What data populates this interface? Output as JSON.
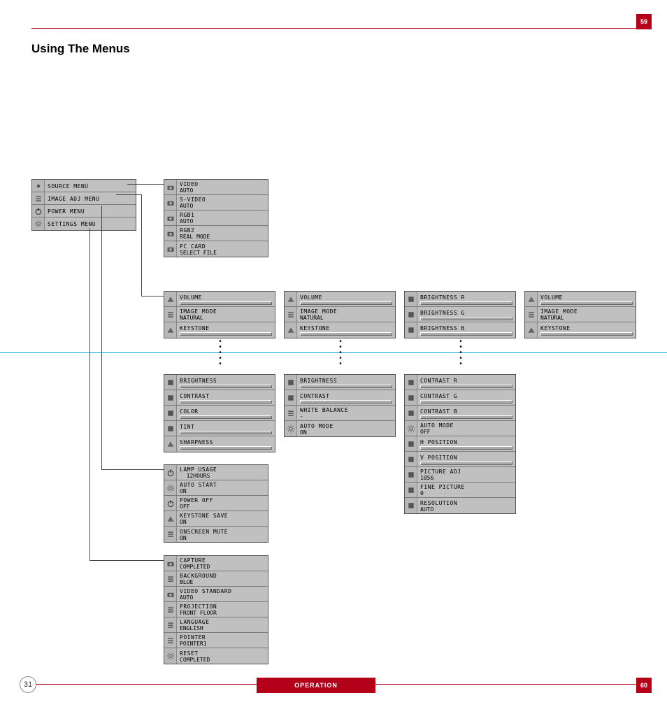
{
  "page": {
    "top_right_number": "59",
    "title": "Using The Menus",
    "footer_circle": "31",
    "footer_band": "OPERATION",
    "footer_right_number": "60"
  },
  "main_menu": [
    {
      "label": "SOURCE MENU"
    },
    {
      "label": "IMAGE ADJ MENU"
    },
    {
      "label": "POWER MENU"
    },
    {
      "label": "SETTINGS MENU"
    }
  ],
  "source_menu": [
    {
      "label": "VIDEO",
      "value": "AUTO"
    },
    {
      "label": "S-VIDEO",
      "value": "AUTO"
    },
    {
      "label": "RGB1",
      "value": "AUTO"
    },
    {
      "label": "RGB2",
      "value": "REAL MODE"
    },
    {
      "label": "PC CARD",
      "value": "SELECT FILE"
    }
  ],
  "img_adj_a": [
    {
      "label": "VOLUME",
      "slider": true,
      "value": "-"
    },
    {
      "label": "IMAGE MODE",
      "value": "NATURAL"
    },
    {
      "label": "KEYSTONE",
      "slider": true,
      "value": "-"
    }
  ],
  "img_adj_a2": [
    {
      "label": "BRIGHTNESS",
      "slider": true,
      "value": "-"
    },
    {
      "label": "CONTRAST",
      "slider": true,
      "value": "-"
    },
    {
      "label": "COLOR",
      "slider": true,
      "value": "-"
    },
    {
      "label": "TINT",
      "slider": true,
      "value": "-"
    },
    {
      "label": "SHARPNESS",
      "slider": true,
      "value": "-"
    }
  ],
  "img_adj_b": [
    {
      "label": "VOLUME",
      "slider": true,
      "value": "-"
    },
    {
      "label": "IMAGE MODE",
      "value": "NATURAL"
    },
    {
      "label": "KEYSTONE",
      "slider": true,
      "value": "-"
    }
  ],
  "img_adj_b2": [
    {
      "label": "BRIGHTNESS",
      "slider": true,
      "value": "-"
    },
    {
      "label": "CONTRAST",
      "slider": true,
      "value": "-"
    },
    {
      "label": "WHITE BALANCE",
      "value": "-"
    },
    {
      "label": "AUTO MODE",
      "value": "ON"
    }
  ],
  "img_adj_c": [
    {
      "label": "BRIGHTNESS R",
      "slider": true,
      "value": "-"
    },
    {
      "label": "BRIGHTNESS G",
      "slider": true,
      "value": "-"
    },
    {
      "label": "BRIGHTNESS B",
      "slider": true,
      "value": "-"
    }
  ],
  "img_adj_c2": [
    {
      "label": "CONTRAST R",
      "slider": true,
      "value": "-"
    },
    {
      "label": "CONTRAST G",
      "slider": true,
      "value": "-"
    },
    {
      "label": "CONTRAST B",
      "slider": true,
      "value": "-"
    },
    {
      "label": "AUTO MODE",
      "value": "OFF"
    },
    {
      "label": "H POSITION",
      "slider": true,
      "value": "-"
    },
    {
      "label": "V POSITION",
      "slider": true,
      "value": "-"
    },
    {
      "label": "PICTURE ADJ",
      "value": "1056"
    },
    {
      "label": "FINE PICTURE",
      "value": "0"
    },
    {
      "label": "RESOLUTION",
      "value": "AUTO"
    }
  ],
  "img_adj_d": [
    {
      "label": "VOLUME",
      "slider": true,
      "value": "-"
    },
    {
      "label": "IMAGE MODE",
      "value": "NATURAL"
    },
    {
      "label": "KEYSTONE",
      "slider": true,
      "value": "-"
    }
  ],
  "power_menu": [
    {
      "label": "LAMP USAGE",
      "value": "  12HOURS"
    },
    {
      "label": "AUTO START",
      "value": "ON"
    },
    {
      "label": "POWER OFF",
      "value": "OFF"
    },
    {
      "label": "KEYSTONE SAVE",
      "value": "ON"
    },
    {
      "label": "ONSCREEN MUTE",
      "value": "ON"
    }
  ],
  "settings_menu": [
    {
      "label": "CAPTURE",
      "value": "COMPLETED"
    },
    {
      "label": "BACKGROUND",
      "value": "BLUE"
    },
    {
      "label": "VIDEO STANDARD",
      "value": "AUTO"
    },
    {
      "label": "PROJECTION",
      "value": "FRONT FLOOR"
    },
    {
      "label": "LANGUAGE",
      "value": "ENGLISH"
    },
    {
      "label": "POINTER",
      "value": "POINTER1"
    },
    {
      "label": "RESET",
      "value": "COMPLETED"
    }
  ]
}
